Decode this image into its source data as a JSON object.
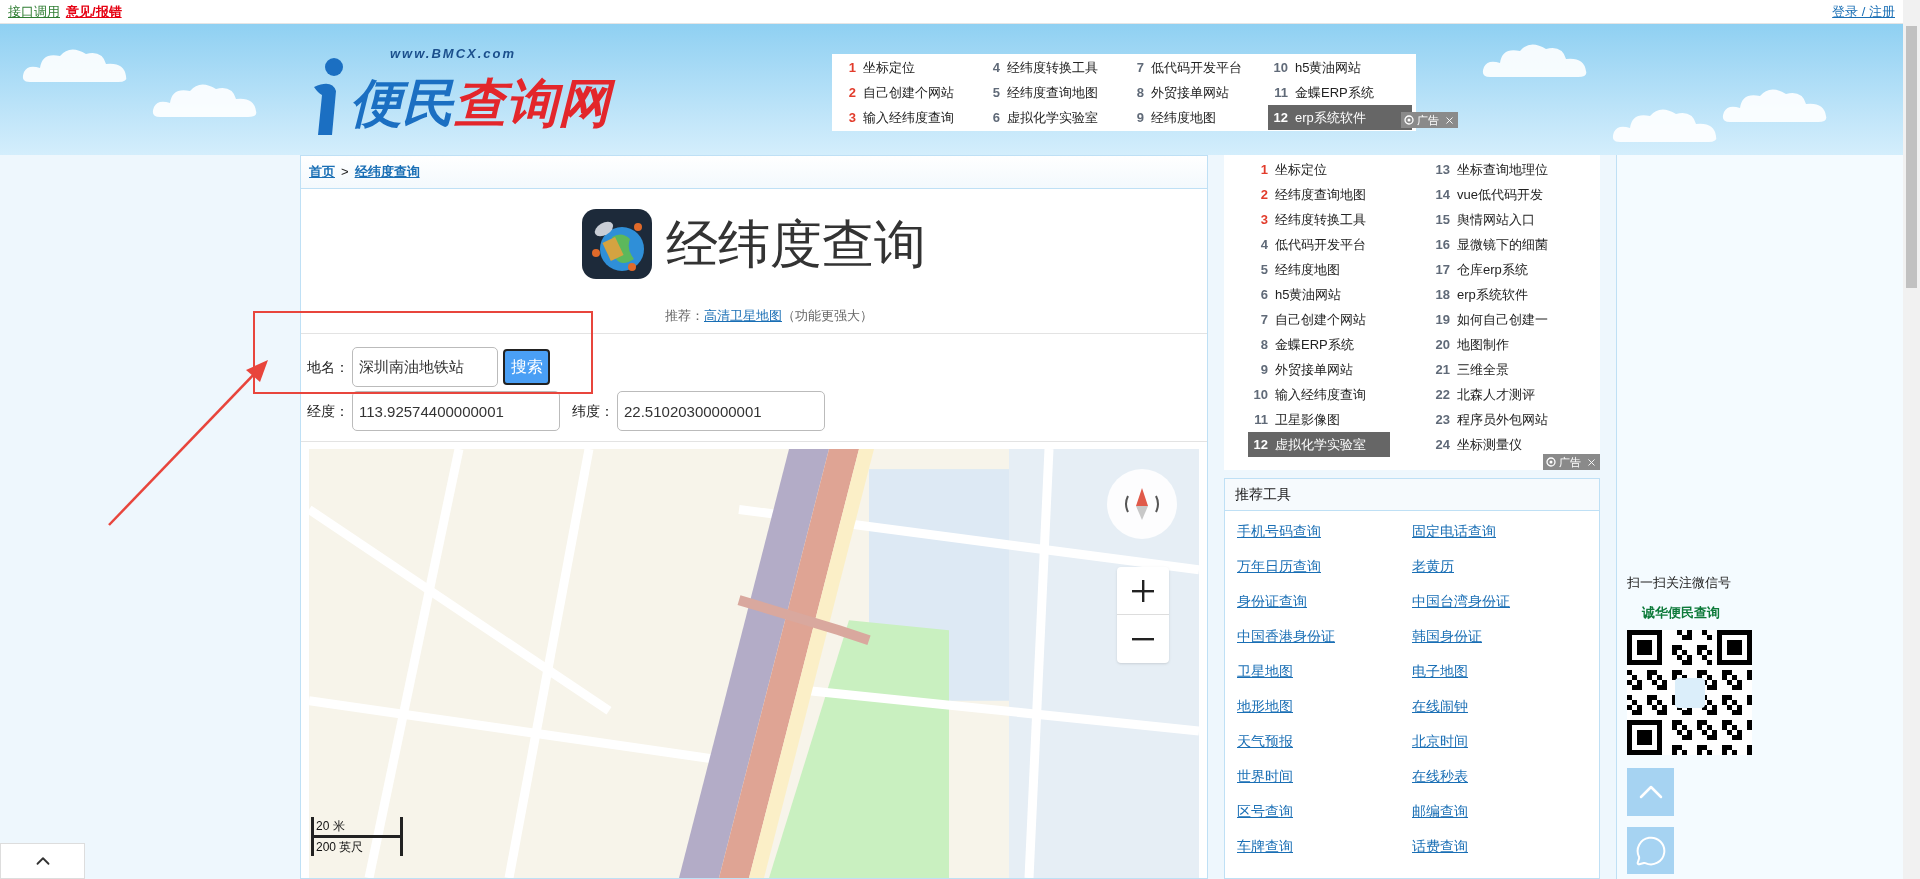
{
  "top_bar": {
    "links": [
      {
        "label": "接口调用",
        "kind": "plain"
      },
      {
        "label": "意见/报错",
        "kind": "alert"
      }
    ],
    "account": "登录 / 注册"
  },
  "logo": {
    "domain": "www.BMCX.com",
    "name_left": "便民",
    "name_right": "查询网"
  },
  "top_ads": {
    "ad_label": "广告",
    "items": [
      {
        "rank": "1",
        "label": "坐标定位",
        "hot": true,
        "selected": false
      },
      {
        "rank": "2",
        "label": "自己创建个网站",
        "hot": true,
        "selected": false
      },
      {
        "rank": "3",
        "label": "输入经纬度查询",
        "hot": true,
        "selected": false
      },
      {
        "rank": "4",
        "label": "经纬度转换工具",
        "hot": false,
        "selected": false
      },
      {
        "rank": "5",
        "label": "经纬度查询地图",
        "hot": false,
        "selected": false
      },
      {
        "rank": "6",
        "label": "虚拟化学实验室",
        "hot": false,
        "selected": false
      },
      {
        "rank": "7",
        "label": "低代码开发平台",
        "hot": false,
        "selected": false
      },
      {
        "rank": "8",
        "label": "外贸接单网站",
        "hot": false,
        "selected": false
      },
      {
        "rank": "9",
        "label": "经纬度地图",
        "hot": false,
        "selected": false
      },
      {
        "rank": "10",
        "label": "h5黄油网站",
        "hot": false,
        "selected": false
      },
      {
        "rank": "11",
        "label": "金蝶ERP系统",
        "hot": false,
        "selected": false
      },
      {
        "rank": "12",
        "label": "erp系统软件",
        "hot": false,
        "selected": true
      }
    ]
  },
  "breadcrumb": {
    "items": [
      "首页",
      "经纬度查询"
    ],
    "separator": ">"
  },
  "page_title": "经纬度查询",
  "recommend": {
    "prefix": "推荐：",
    "link": "高清卫星地图",
    "suffix": "（功能更强大）"
  },
  "form": {
    "place": {
      "label": "地名：",
      "value": "深圳南油地铁站"
    },
    "search_button": "搜索",
    "longitude": {
      "label": "经度：",
      "value": "113.92574400000001"
    },
    "latitude": {
      "label": "纬度：",
      "value": "22.51020300000001"
    }
  },
  "map": {
    "scale_metric": "20 米",
    "scale_imperial": "200 英尺"
  },
  "side_ads": {
    "ad_label": "广告",
    "items": [
      {
        "rank": "1",
        "label": "坐标定位",
        "hot": true,
        "selected": false
      },
      {
        "rank": "2",
        "label": "经纬度查询地图",
        "hot": true,
        "selected": false
      },
      {
        "rank": "3",
        "label": "经纬度转换工具",
        "hot": true,
        "selected": false
      },
      {
        "rank": "4",
        "label": "低代码开发平台",
        "hot": false,
        "selected": false
      },
      {
        "rank": "5",
        "label": "经纬度地图",
        "hot": false,
        "selected": false
      },
      {
        "rank": "6",
        "label": "h5黄油网站",
        "hot": false,
        "selected": false
      },
      {
        "rank": "7",
        "label": "自己创建个网站",
        "hot": false,
        "selected": false
      },
      {
        "rank": "8",
        "label": "金蝶ERP系统",
        "hot": false,
        "selected": false
      },
      {
        "rank": "9",
        "label": "外贸接单网站",
        "hot": false,
        "selected": false
      },
      {
        "rank": "10",
        "label": "输入经纬度查询",
        "hot": false,
        "selected": false
      },
      {
        "rank": "11",
        "label": "卫星影像图",
        "hot": false,
        "selected": false
      },
      {
        "rank": "12",
        "label": "虚拟化学实验室",
        "hot": false,
        "selected": true
      },
      {
        "rank": "13",
        "label": "坐标查询地理位",
        "hot": false,
        "selected": false
      },
      {
        "rank": "14",
        "label": "vue低代码开发",
        "hot": false,
        "selected": false
      },
      {
        "rank": "15",
        "label": "舆情网站入口",
        "hot": false,
        "selected": false
      },
      {
        "rank": "16",
        "label": "显微镜下的细菌",
        "hot": false,
        "selected": false
      },
      {
        "rank": "17",
        "label": "仓库erp系统",
        "hot": false,
        "selected": false
      },
      {
        "rank": "18",
        "label": "erp系统软件",
        "hot": false,
        "selected": false
      },
      {
        "rank": "19",
        "label": "如何自己创建一",
        "hot": false,
        "selected": false
      },
      {
        "rank": "20",
        "label": "地图制作",
        "hot": false,
        "selected": false
      },
      {
        "rank": "21",
        "label": "三维全景",
        "hot": false,
        "selected": false
      },
      {
        "rank": "22",
        "label": "北森人才测评",
        "hot": false,
        "selected": false
      },
      {
        "rank": "23",
        "label": "程序员外包网站",
        "hot": false,
        "selected": false
      },
      {
        "rank": "24",
        "label": "坐标测量仪",
        "hot": false,
        "selected": false
      }
    ]
  },
  "tools": {
    "title": "推荐工具",
    "links": [
      "手机号码查询",
      "固定电话查询",
      "万年日历查询",
      "老黄历",
      "身份证查询",
      "中国台湾身份证",
      "中国香港身份证",
      "韩国身份证",
      "卫星地图",
      "电子地图",
      "地形地图",
      "在线闹钟",
      "天气预报",
      "北京时间",
      "世界时间",
      "在线秒表",
      "区号查询",
      "邮编查询",
      "车牌查询",
      "话费查询"
    ]
  },
  "follow": {
    "caption": "扫一扫关注微信号",
    "account": "诚华便民查询"
  }
}
